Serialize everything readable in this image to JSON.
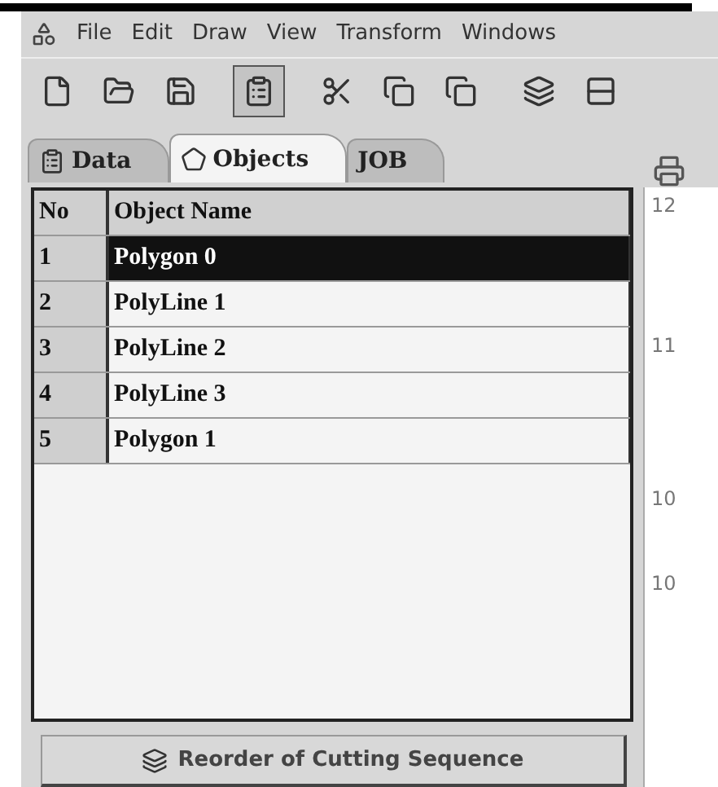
{
  "menu": [
    "File",
    "Edit",
    "Draw",
    "View",
    "Transform",
    "Windows"
  ],
  "toolbar": [
    {
      "kind": "new",
      "pressed": false
    },
    {
      "kind": "open",
      "pressed": false
    },
    {
      "kind": "save",
      "pressed": false
    },
    {
      "kind": "properties",
      "pressed": true
    },
    {
      "kind": "cut",
      "pressed": false
    },
    {
      "kind": "move-right",
      "pressed": false
    },
    {
      "kind": "move-left",
      "pressed": false
    },
    {
      "kind": "cascade",
      "pressed": false
    },
    {
      "kind": "split",
      "pressed": false
    }
  ],
  "tabs": [
    {
      "label": "Data",
      "selected": false
    },
    {
      "label": "Objects",
      "selected": true
    },
    {
      "label": "JOB",
      "selected": false
    }
  ],
  "table": {
    "columns": [
      "No",
      "Object Name"
    ],
    "rows": [
      {
        "no": "1",
        "name": "Polygon 0",
        "selected": true
      },
      {
        "no": "2",
        "name": "PolyLine 1",
        "selected": false
      },
      {
        "no": "3",
        "name": "PolyLine 2",
        "selected": false
      },
      {
        "no": "4",
        "name": "PolyLine 3",
        "selected": false
      },
      {
        "no": "5",
        "name": "Polygon 1",
        "selected": false
      }
    ]
  },
  "reorder_button": "Reorder of Cutting Sequence",
  "ruler_labels": [
    "12",
    "11",
    "10",
    "10"
  ]
}
